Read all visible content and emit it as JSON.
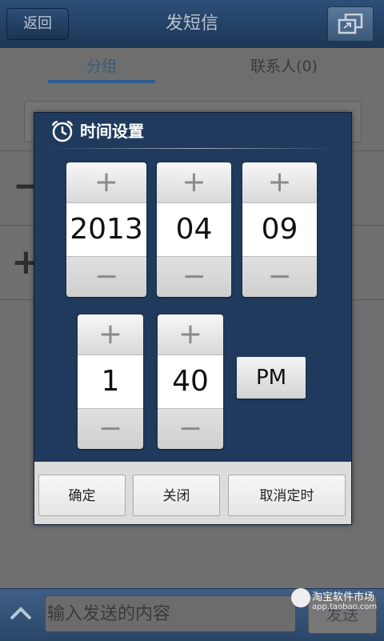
{
  "titlebar": {
    "back_label": "返回",
    "title": "发短信"
  },
  "tabs": [
    {
      "label": "分组"
    },
    {
      "label": "联系人(0)"
    }
  ],
  "dialog": {
    "title": "时间设置",
    "date": {
      "year": "2013",
      "month": "04",
      "day": "09"
    },
    "time": {
      "hour": "1",
      "minute": "40",
      "ampm": "PM"
    },
    "buttons": {
      "confirm": "确定",
      "close": "关闭",
      "cancel_timer": "取消定时"
    }
  },
  "bottom": {
    "input_placeholder": "输入发送的内容",
    "send_label": "发送"
  },
  "watermark": {
    "line1": "淘宝软件市场",
    "line2": "app.taobao.com"
  },
  "icons": {
    "back": "back-arrow-icon",
    "multi_window": "multi-window-icon",
    "clock": "alarm-clock-icon",
    "up": "chevron-up-icon",
    "plus": "plus-icon",
    "minus": "minus-icon"
  },
  "colors": {
    "dialog_bg": "#1f3a5c",
    "titlebar": "#2c4f78",
    "tab_accent": "#2e5c8e"
  }
}
